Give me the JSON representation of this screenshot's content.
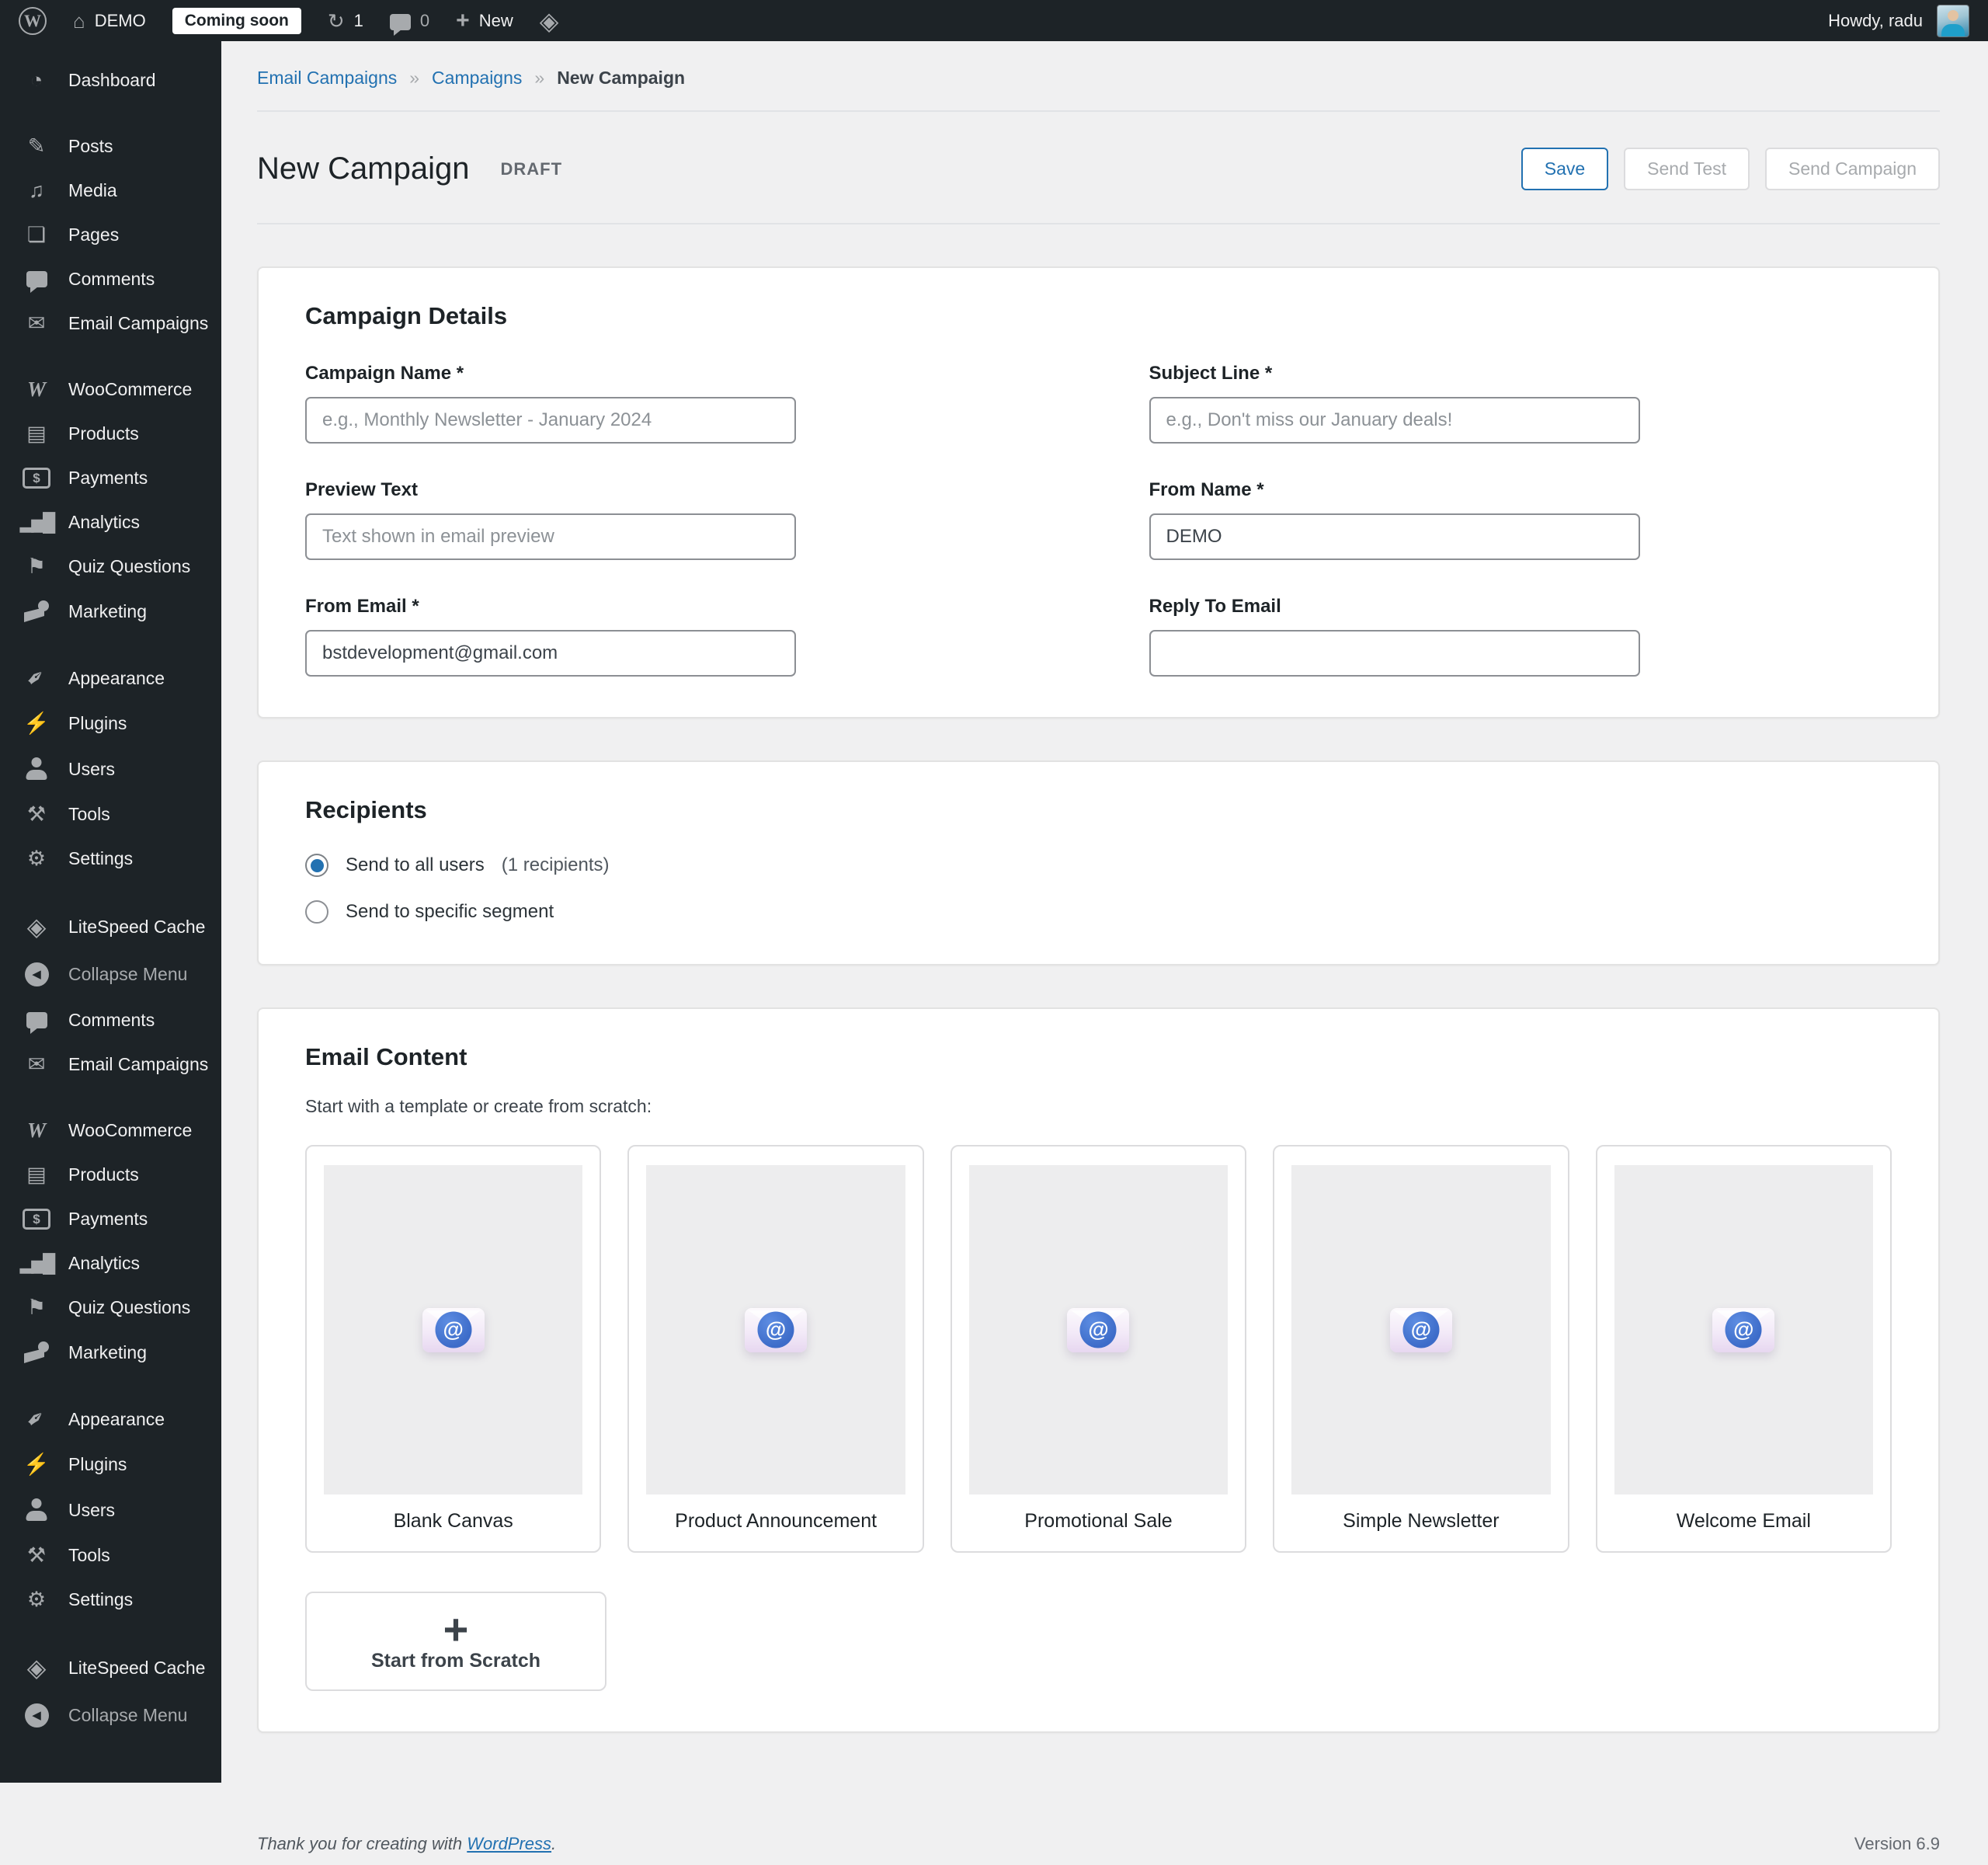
{
  "admin_bar": {
    "site_name": "DEMO",
    "coming_soon_label": "Coming soon",
    "update_count": "1",
    "comment_count": "0",
    "new_label": "New",
    "howdy": "Howdy, radu"
  },
  "sidebar": {
    "items": [
      {
        "label": "Dashboard",
        "icon": "dashboard-icon",
        "gap": false,
        "muted": false
      },
      {
        "label": "Posts",
        "icon": "posts-icon",
        "gap": true,
        "muted": false
      },
      {
        "label": "Media",
        "icon": "media-icon",
        "gap": false,
        "muted": false
      },
      {
        "label": "Pages",
        "icon": "pages-icon",
        "gap": false,
        "muted": false
      },
      {
        "label": "Comments",
        "icon": "comments-icon",
        "gap": false,
        "muted": false
      },
      {
        "label": "Email Campaigns",
        "icon": "email-campaigns-icon",
        "gap": false,
        "muted": false
      },
      {
        "label": "WooCommerce",
        "icon": "woocommerce-icon",
        "gap": true,
        "muted": false
      },
      {
        "label": "Products",
        "icon": "products-icon",
        "gap": false,
        "muted": false
      },
      {
        "label": "Payments",
        "icon": "payments-icon",
        "gap": false,
        "muted": false
      },
      {
        "label": "Analytics",
        "icon": "analytics-icon",
        "gap": false,
        "muted": false
      },
      {
        "label": "Quiz Questions",
        "icon": "quiz-questions-icon",
        "gap": false,
        "muted": false
      },
      {
        "label": "Marketing",
        "icon": "marketing-icon",
        "gap": false,
        "muted": false
      },
      {
        "label": "Appearance",
        "icon": "appearance-icon",
        "gap": true,
        "muted": false
      },
      {
        "label": "Plugins",
        "icon": "plugins-icon",
        "gap": false,
        "muted": false
      },
      {
        "label": "Users",
        "icon": "users-icon",
        "gap": false,
        "muted": false
      },
      {
        "label": "Tools",
        "icon": "tools-icon",
        "gap": false,
        "muted": false
      },
      {
        "label": "Settings",
        "icon": "settings-icon",
        "gap": false,
        "muted": false
      },
      {
        "label": "LiteSpeed Cache",
        "icon": "litespeed-icon",
        "gap": true,
        "muted": false
      },
      {
        "label": "Collapse Menu",
        "icon": "collapse-icon",
        "gap": false,
        "muted": true
      },
      {
        "label": "Comments",
        "icon": "comments-icon",
        "gap": false,
        "muted": false
      },
      {
        "label": "Email Campaigns",
        "icon": "email-campaigns-icon",
        "gap": false,
        "muted": false
      },
      {
        "label": "WooCommerce",
        "icon": "woocommerce-icon",
        "gap": true,
        "muted": false
      },
      {
        "label": "Products",
        "icon": "products-icon",
        "gap": false,
        "muted": false
      },
      {
        "label": "Payments",
        "icon": "payments-icon",
        "gap": false,
        "muted": false
      },
      {
        "label": "Analytics",
        "icon": "analytics-icon",
        "gap": false,
        "muted": false
      },
      {
        "label": "Quiz Questions",
        "icon": "quiz-questions-icon",
        "gap": false,
        "muted": false
      },
      {
        "label": "Marketing",
        "icon": "marketing-icon",
        "gap": false,
        "muted": false
      },
      {
        "label": "Appearance",
        "icon": "appearance-icon",
        "gap": true,
        "muted": false
      },
      {
        "label": "Plugins",
        "icon": "plugins-icon",
        "gap": false,
        "muted": false
      },
      {
        "label": "Users",
        "icon": "users-icon",
        "gap": false,
        "muted": false
      },
      {
        "label": "Tools",
        "icon": "tools-icon",
        "gap": false,
        "muted": false
      },
      {
        "label": "Settings",
        "icon": "settings-icon",
        "gap": false,
        "muted": false
      },
      {
        "label": "LiteSpeed Cache",
        "icon": "litespeed-icon",
        "gap": true,
        "muted": false
      },
      {
        "label": "Collapse Menu",
        "icon": "collapse-icon",
        "gap": false,
        "muted": true
      }
    ]
  },
  "breadcrumb": {
    "items": [
      "Email Campaigns",
      "Campaigns"
    ],
    "current": "New Campaign",
    "separator": "»"
  },
  "header": {
    "title": "New Campaign",
    "status_label": "DRAFT",
    "save_label": "Save",
    "send_test_label": "Send Test",
    "send_campaign_label": "Send Campaign"
  },
  "campaign_details": {
    "heading": "Campaign Details",
    "fields": {
      "campaign_name": {
        "label": "Campaign Name *",
        "placeholder": "e.g., Monthly Newsletter - January 2024",
        "value": ""
      },
      "subject_line": {
        "label": "Subject Line *",
        "placeholder": "e.g., Don't miss our January deals!",
        "value": ""
      },
      "preview_text": {
        "label": "Preview Text",
        "placeholder": "Text shown in email preview",
        "value": ""
      },
      "from_name": {
        "label": "From Name *",
        "placeholder": "",
        "value": "DEMO"
      },
      "from_email": {
        "label": "From Email *",
        "placeholder": "",
        "value": "bstdevelopment@gmail.com"
      },
      "reply_to_email": {
        "label": "Reply To Email",
        "placeholder": "",
        "value": ""
      }
    }
  },
  "recipients": {
    "heading": "Recipients",
    "options": [
      {
        "label": "Send to all users",
        "note": "(1 recipients)",
        "selected": true
      },
      {
        "label": "Send to specific segment",
        "note": "",
        "selected": false
      }
    ]
  },
  "email_content": {
    "heading": "Email Content",
    "subtext": "Start with a template or create from scratch:",
    "templates": [
      "Blank Canvas",
      "Product Announcement",
      "Promotional Sale",
      "Simple Newsletter",
      "Welcome Email"
    ],
    "scratch_plus": "+",
    "scratch_label": "Start from Scratch"
  },
  "footer": {
    "thanks_prefix": "Thank you for creating with ",
    "link_label": "WordPress",
    "thanks_suffix": ".",
    "version": "Version 6.9"
  },
  "colors": {
    "admin_bar_bg": "#1d2327",
    "sidebar_bg": "#1d2327",
    "content_bg": "#f0f0f1",
    "accent_blue": "#2271b1",
    "muted_gray": "#a7aaad",
    "template_icon_blue": "#3d6cc9"
  }
}
